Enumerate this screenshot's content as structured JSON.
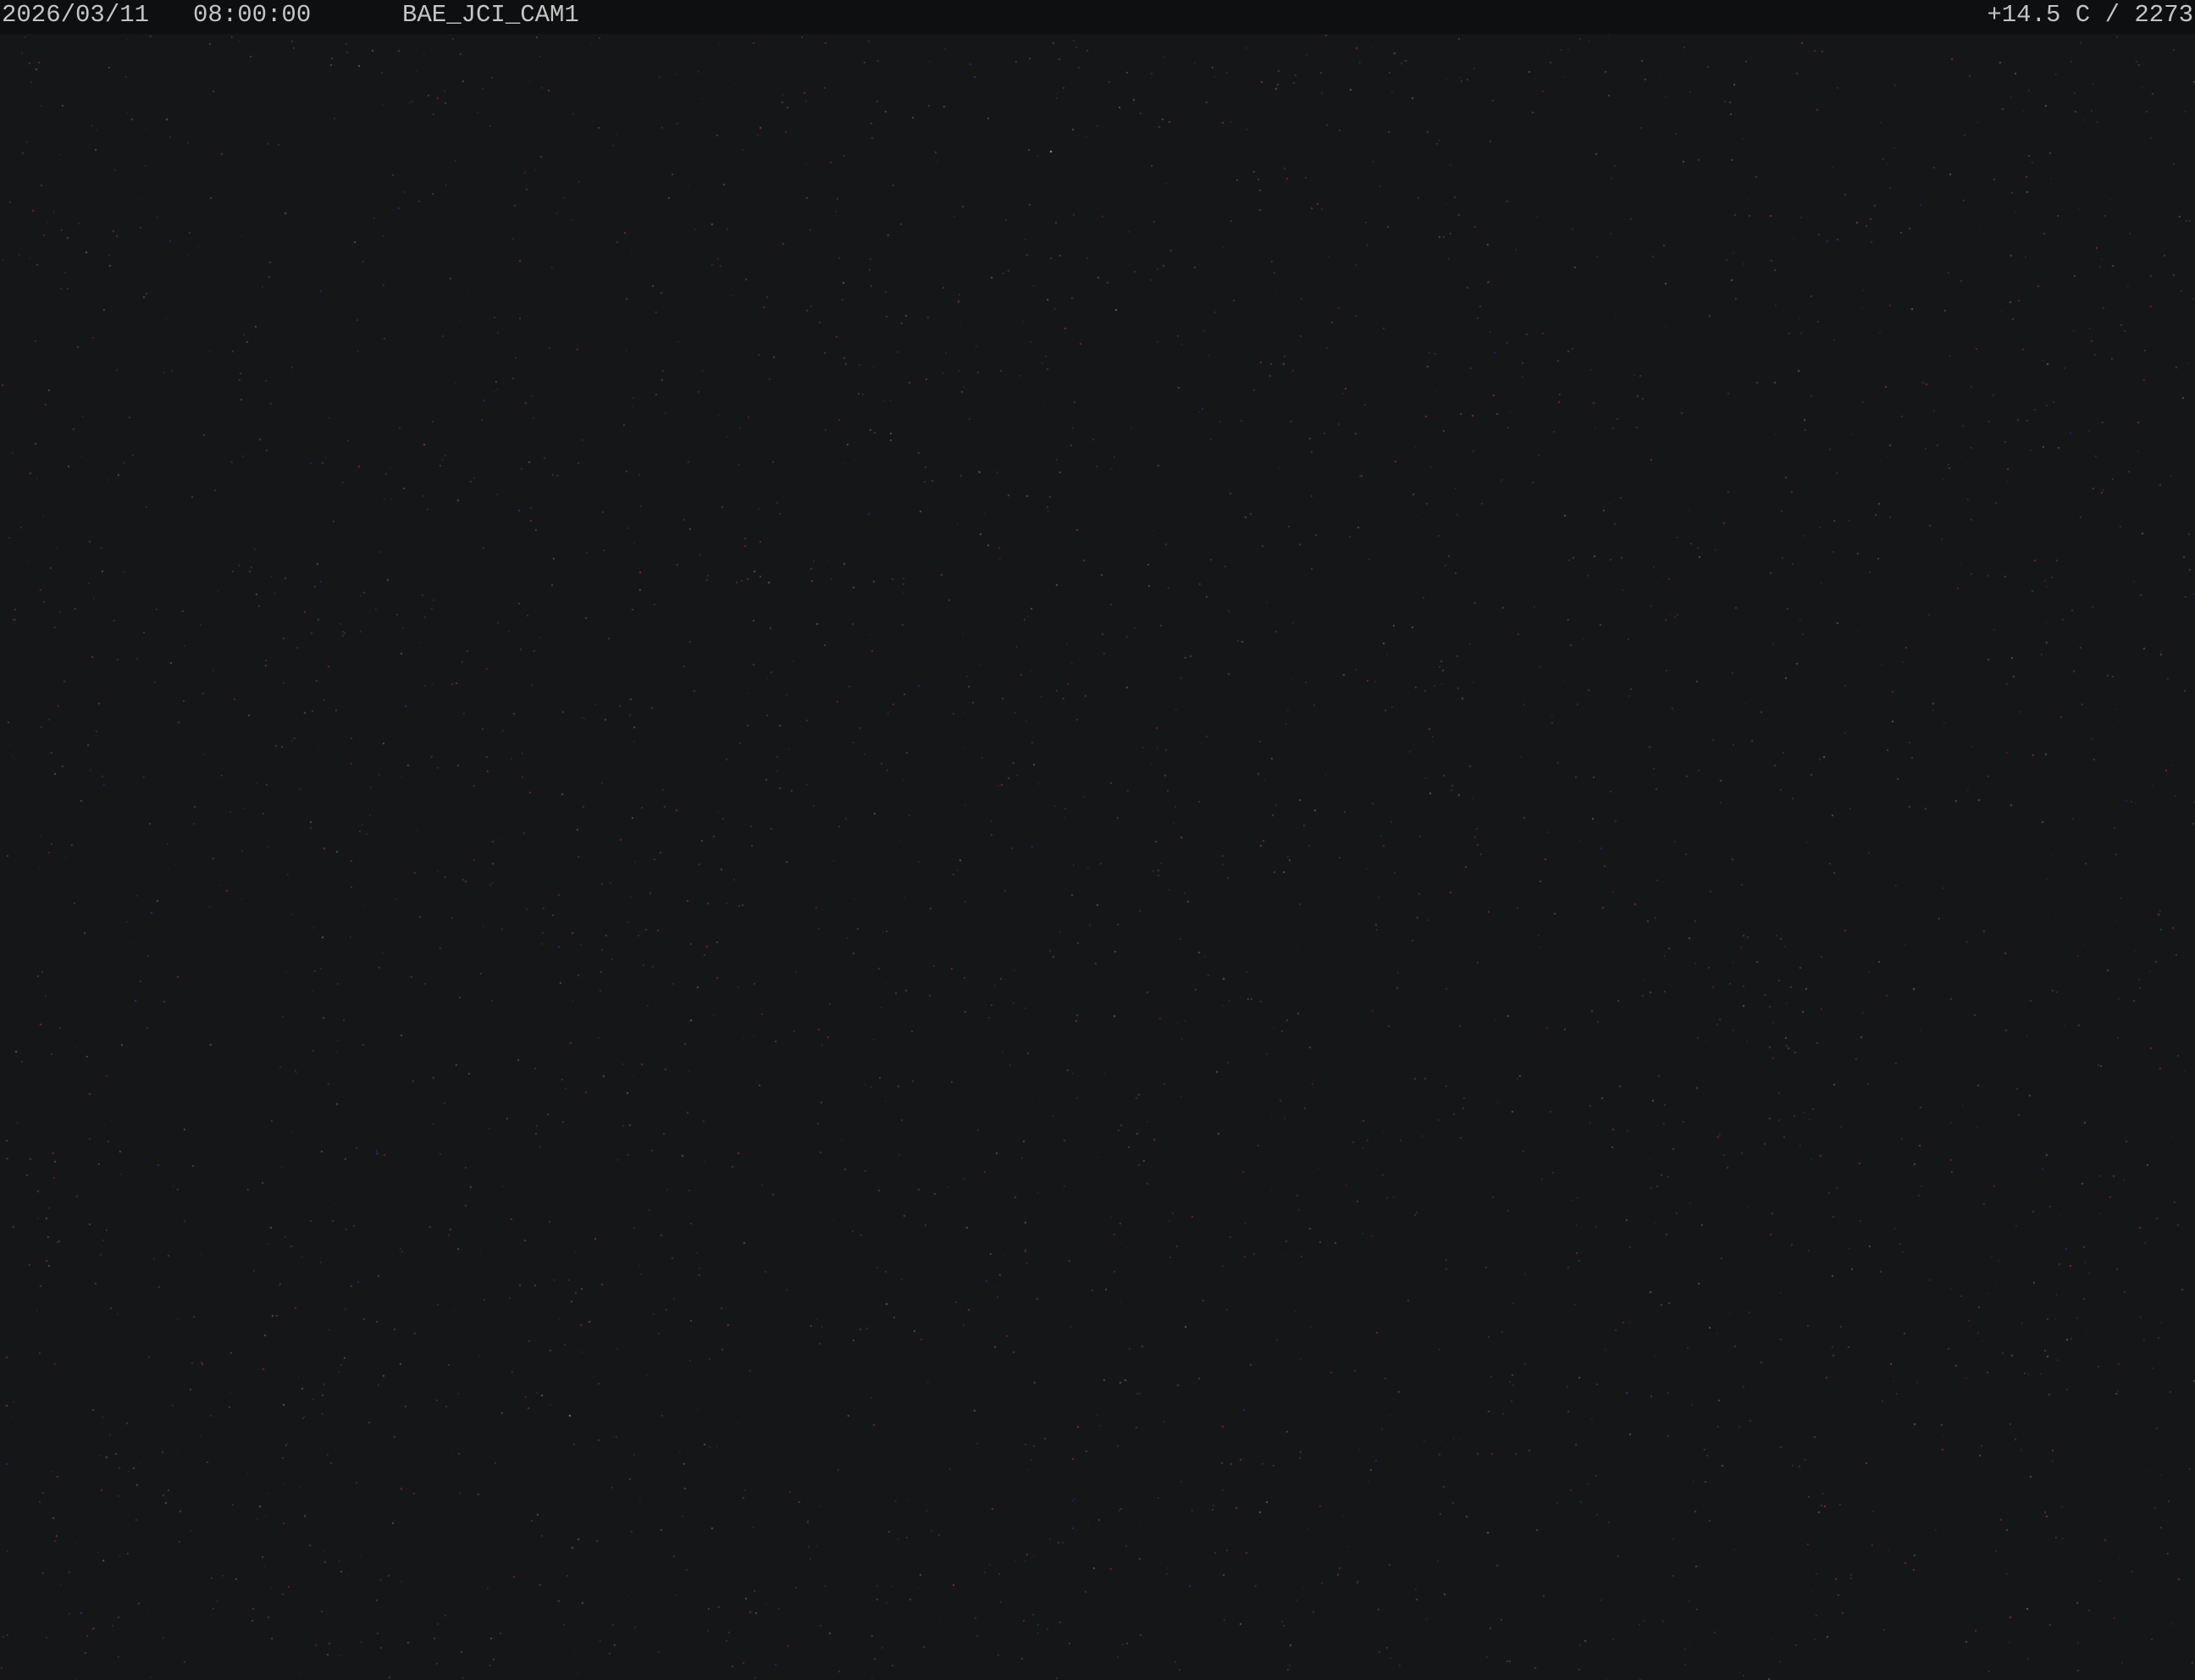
{
  "overlay": {
    "date": "2026/03/11",
    "time": "08:00:00",
    "camera_id": "BAE_JCI_CAM1",
    "status": "+14.5 C / 2273"
  },
  "colors": {
    "background": "#151617",
    "overlay_bar": "#0e0f10",
    "overlay_text": "#c4c4c4",
    "noise": [
      "#7a2a35",
      "#8a2d3b",
      "#3a3f52",
      "#2b2f6a",
      "#3f4a3f",
      "#5a5a5a",
      "#c5d050"
    ]
  }
}
